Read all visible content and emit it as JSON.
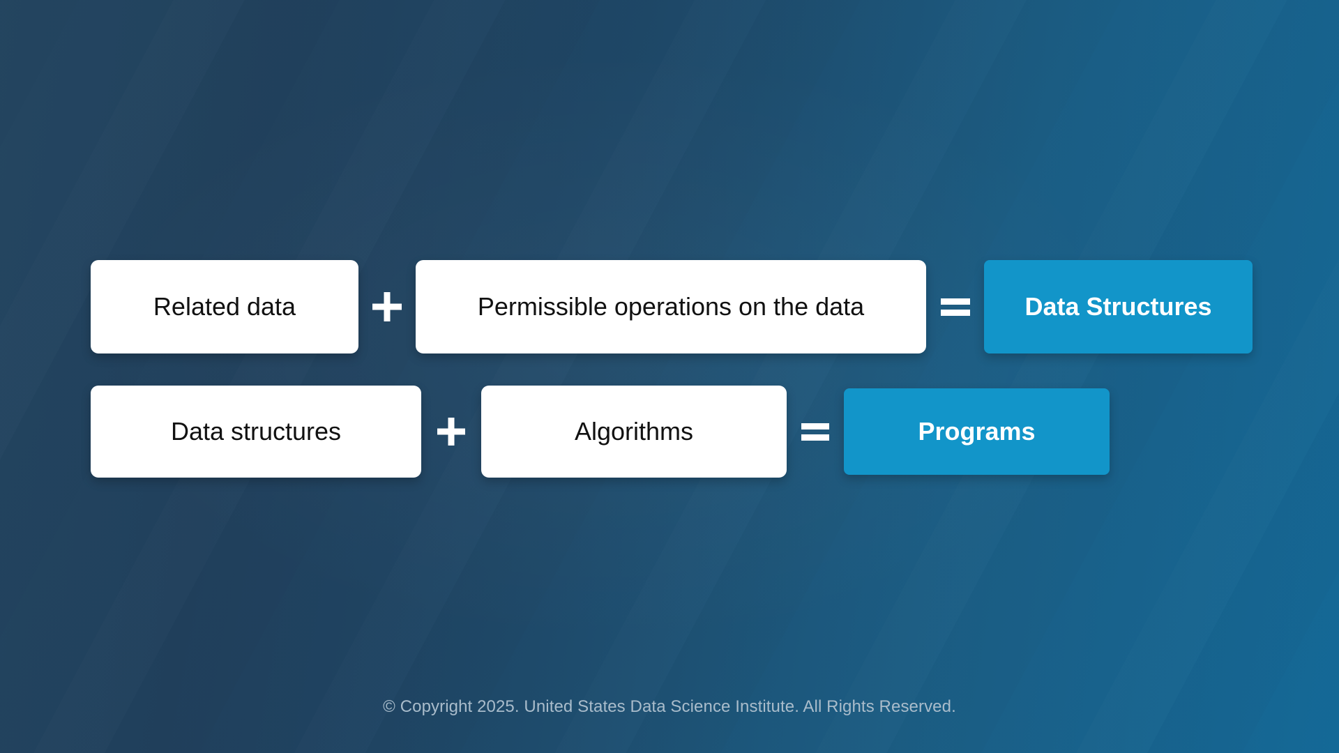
{
  "slide": {
    "background": {
      "gradient_from": "#244561",
      "gradient_to": "#146a99"
    },
    "accent_color": "#1295c9",
    "box_fill": "#ffffff",
    "box_text_color": "#111111",
    "result_text_color": "#ffffff"
  },
  "equations": [
    {
      "id": "row-1",
      "terms": [
        {
          "label": "Related data",
          "kind": "term"
        },
        {
          "label": "+",
          "kind": "operator",
          "icon": "plus-icon"
        },
        {
          "label": "Permissible operations on the data",
          "kind": "term"
        },
        {
          "label": "=",
          "kind": "operator",
          "icon": "equals-icon"
        },
        {
          "label": "Data Structures",
          "kind": "result"
        }
      ]
    },
    {
      "id": "row-2",
      "terms": [
        {
          "label": "Data structures",
          "kind": "term"
        },
        {
          "label": "+",
          "kind": "operator",
          "icon": "plus-icon"
        },
        {
          "label": "Algorithms",
          "kind": "term"
        },
        {
          "label": "=",
          "kind": "operator",
          "icon": "equals-icon"
        },
        {
          "label": "Programs",
          "kind": "result"
        }
      ]
    }
  ],
  "footer": {
    "copyright": "© Copyright 2025. United States Data Science Institute. All Rights Reserved."
  }
}
